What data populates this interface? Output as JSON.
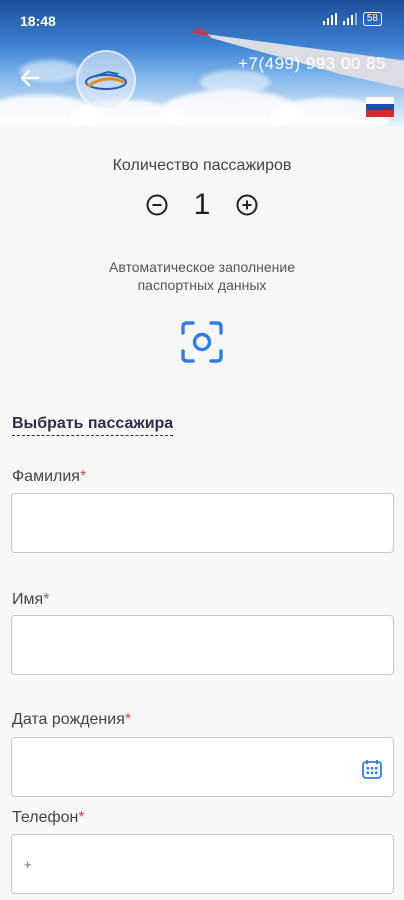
{
  "status_bar": {
    "time": "18:48",
    "battery": "58"
  },
  "header": {
    "phone": "+7(499) 993 00 85"
  },
  "passengers": {
    "label": "Количество пассажиров",
    "count": "1"
  },
  "auto_fill": {
    "line1": "Автоматическое заполнение",
    "line2": "паспортных данных"
  },
  "select_passenger": "Выбрать пассажира",
  "fields": {
    "surname": {
      "label": "Фамилия",
      "required": "*"
    },
    "name": {
      "label": "Имя",
      "required": "*"
    },
    "birth_date": {
      "label": "Дата рождения",
      "required": "*"
    },
    "phone": {
      "label": "Телефон",
      "required": "*",
      "prefix": "+"
    }
  },
  "colors": {
    "accent": "#2e7ee0",
    "required": "#e0443c"
  }
}
